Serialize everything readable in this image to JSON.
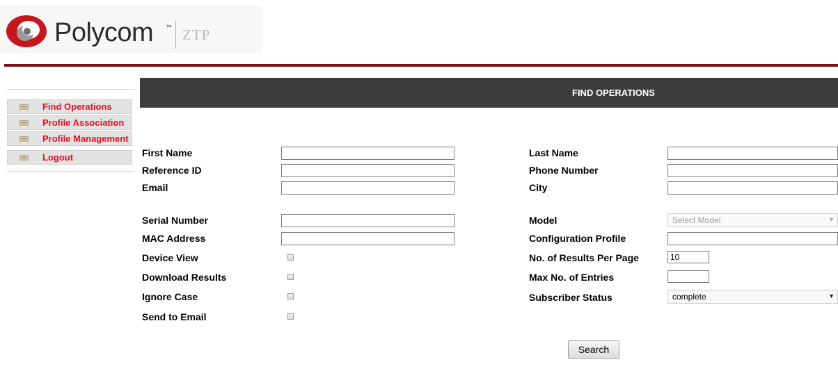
{
  "brand": {
    "name": "Polycom",
    "product": "ZTP"
  },
  "sidebar": {
    "items": [
      {
        "label": "Find Operations"
      },
      {
        "label": "Profile Association"
      },
      {
        "label": "Profile Management"
      },
      {
        "label": "Logout"
      }
    ]
  },
  "title": "FIND OPERATIONS",
  "form": {
    "first_name": {
      "label": "First Name",
      "value": ""
    },
    "reference_id": {
      "label": "Reference ID",
      "value": ""
    },
    "email": {
      "label": "Email",
      "value": ""
    },
    "serial_number": {
      "label": "Serial Number",
      "value": ""
    },
    "mac_address": {
      "label": "MAC Address",
      "value": ""
    },
    "device_view": {
      "label": "Device View"
    },
    "download_results": {
      "label": "Download Results"
    },
    "ignore_case": {
      "label": "Ignore Case"
    },
    "send_to_email": {
      "label": "Send to Email"
    },
    "last_name": {
      "label": "Last Name",
      "value": ""
    },
    "phone_number": {
      "label": "Phone Number",
      "value": ""
    },
    "city": {
      "label": "City",
      "value": ""
    },
    "model": {
      "label": "Model",
      "placeholder": "Select Model"
    },
    "configuration_profile": {
      "label": "Configuration Profile",
      "value": ""
    },
    "results_per_page": {
      "label": "No. of Results Per Page",
      "value": "10"
    },
    "max_entries": {
      "label": "Max No. of Entries",
      "value": ""
    },
    "subscriber_status": {
      "label": "Subscriber Status",
      "value": "complete"
    },
    "search_label": "Search"
  },
  "colors": {
    "accent_red": "#e8101e",
    "rule": "#7a1218",
    "title_bar": "#3c3c3c"
  }
}
